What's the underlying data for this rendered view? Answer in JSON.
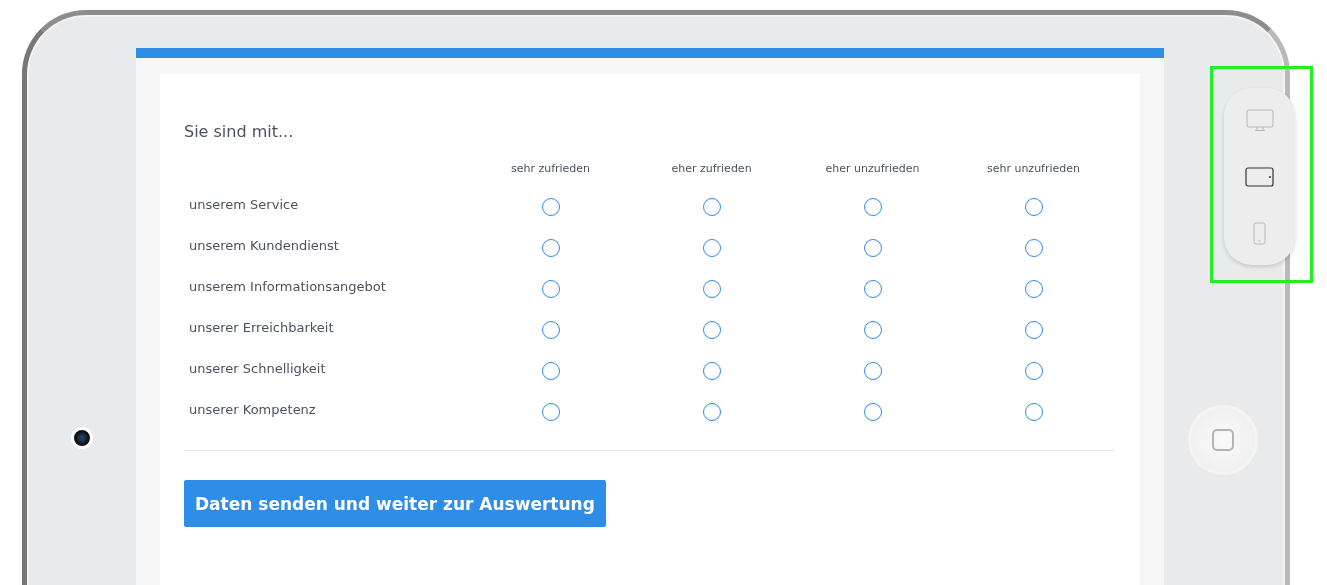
{
  "survey": {
    "title": "Sie sind mit...",
    "columns": [
      "sehr zufrieden",
      "eher zufrieden",
      "eher unzufrieden",
      "sehr unzufrieden"
    ],
    "rows": [
      {
        "label": "unserem Service",
        "choices": [
          {
            "selected": false
          },
          {
            "selected": false
          },
          {
            "selected": false
          },
          {
            "selected": false
          }
        ]
      },
      {
        "label": "unserem Kundendienst",
        "choices": [
          {
            "selected": false
          },
          {
            "selected": false
          },
          {
            "selected": false
          },
          {
            "selected": false
          }
        ]
      },
      {
        "label": "unserem Informationsangebot",
        "choices": [
          {
            "selected": false
          },
          {
            "selected": false
          },
          {
            "selected": false
          },
          {
            "selected": false
          }
        ]
      },
      {
        "label": "unserer Erreichbarkeit",
        "choices": [
          {
            "selected": false
          },
          {
            "selected": false
          },
          {
            "selected": false
          },
          {
            "selected": false
          }
        ]
      },
      {
        "label": "unserer Schnelligkeit",
        "choices": [
          {
            "selected": false
          },
          {
            "selected": false
          },
          {
            "selected": false
          },
          {
            "selected": false
          }
        ]
      },
      {
        "label": "unserer Kompetenz",
        "choices": [
          {
            "selected": false
          },
          {
            "selected": false
          },
          {
            "selected": false
          },
          {
            "selected": false
          }
        ]
      }
    ],
    "submit_button": "Daten senden und weiter zur Auswertung"
  },
  "device_switcher": {
    "items": [
      {
        "kind": "desktop",
        "selected": false
      },
      {
        "kind": "tablet",
        "selected": true
      },
      {
        "kind": "phone",
        "selected": false
      }
    ]
  }
}
